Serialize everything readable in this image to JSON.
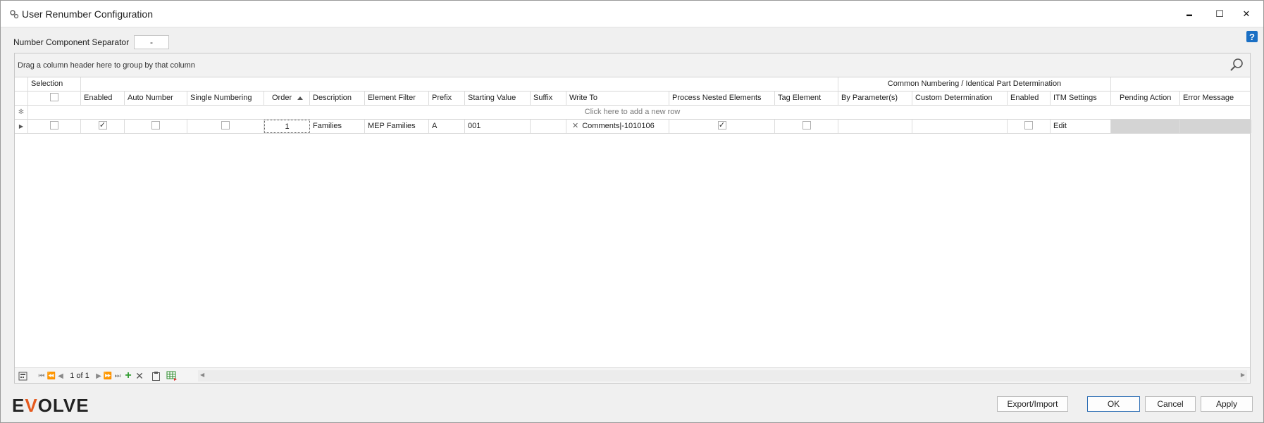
{
  "window": {
    "title": "User Renumber Configuration",
    "controls": {
      "minimize": "▬",
      "maximize": "☐",
      "close": "✕"
    },
    "help_glyph": "?"
  },
  "separator": {
    "label": "Number Component Separator",
    "value": "-"
  },
  "grid": {
    "group_panel_text": "Drag a column header here to group by that column",
    "bands": {
      "selection": "Selection",
      "common": "Common Numbering / Identical Part Determination"
    },
    "columns": {
      "enabled": "Enabled",
      "auto_number": "Auto Number",
      "single_numbering": "Single Numbering",
      "order": "Order",
      "description": "Description",
      "element_filter": "Element Filter",
      "prefix": "Prefix",
      "starting_value": "Starting Value",
      "suffix": "Suffix",
      "write_to": "Write To",
      "process_nested": "Process Nested Elements",
      "tag_element": "Tag Element",
      "by_parameters": "By Parameter(s)",
      "custom_determination": "Custom Determination",
      "enabled2": "Enabled",
      "itm_settings": "ITM Settings",
      "pending_action": "Pending Action",
      "error_message": "Error Message"
    },
    "new_row_text": "Click here to add a new row",
    "rows": [
      {
        "selection": false,
        "enabled": true,
        "auto_number": false,
        "single_numbering": false,
        "order": "1",
        "description": "Families",
        "element_filter": "MEP Families",
        "prefix": "A",
        "starting_value": "001",
        "suffix": "",
        "write_to": "Comments|-1010106",
        "process_nested": true,
        "tag_element": false,
        "by_parameters": "",
        "custom_determination": "",
        "enabled2": false,
        "itm_settings": "Edit",
        "pending_action": "",
        "error_message": ""
      }
    ],
    "navigator": {
      "page_text": "1 of 1"
    }
  },
  "footer": {
    "logo_parts": [
      "E",
      "V",
      "OLVE"
    ],
    "buttons": {
      "export_import": "Export/Import",
      "ok": "OK",
      "cancel": "Cancel",
      "apply": "Apply"
    }
  },
  "colors": {
    "accent": "#1a6fc4",
    "logo_v": "#e55a1e",
    "add_green": "#2e9b2e"
  }
}
